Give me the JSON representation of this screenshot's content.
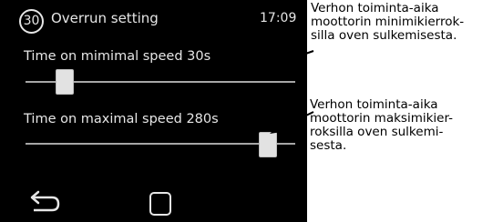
{
  "header": {
    "badge": "30",
    "title": "Overrun setting",
    "clock": "17:09"
  },
  "sliders": [
    {
      "label": "Time on mimimal speed 30s",
      "level_fraction": 0.12
    },
    {
      "label": "Time on maximal speed 280s",
      "level_fraction": 0.92
    }
  ],
  "navbar": {
    "back": "back-arrow-icon",
    "home": "home-square-icon"
  },
  "annotations": [
    {
      "lines": [
        "Verhon toiminta-aika",
        "moottorin minimikierrok-",
        "silla oven sulkemisesta."
      ]
    },
    {
      "lines": [
        "Verhon toiminta-aika",
        "moottorin maksimikier-",
        "roksilla oven sulkemi-",
        "sesta."
      ]
    }
  ],
  "colors": {
    "screen_bg": "#000000",
    "text": "#e6e6e6",
    "track": "#a6a6a6",
    "thumb": "#e2e2e2"
  }
}
